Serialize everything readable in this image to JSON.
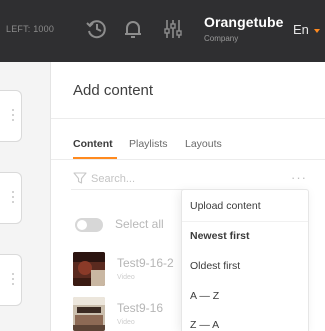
{
  "header": {
    "left_text": "LEFT: 1000",
    "icons": [
      "history-icon",
      "notification-bell-icon",
      "filter-sliders-icon"
    ],
    "company_name": "Orangetube",
    "company_subtitle": "Company",
    "language": "En",
    "accent_color": "#ff8a1f",
    "background_color": "#2f2f31"
  },
  "panel": {
    "title": "Add content",
    "tabs": [
      {
        "label": "Content",
        "active": true
      },
      {
        "label": "Playlists",
        "active": false
      },
      {
        "label": "Layouts",
        "active": false
      }
    ],
    "search": {
      "placeholder": "Search..."
    },
    "select_all_label": "Select all",
    "items": [
      {
        "title": "Test9-16-2",
        "subtitle": "Video"
      },
      {
        "title": "Test9-16",
        "subtitle": "Video"
      }
    ]
  },
  "menu": {
    "items": [
      {
        "label": "Upload content",
        "bold": false
      },
      {
        "label": "Newest first",
        "bold": true
      },
      {
        "label": "Oldest first",
        "bold": false
      },
      {
        "label": "A — Z",
        "bold": false
      },
      {
        "label": "Z — A",
        "bold": false
      }
    ]
  }
}
